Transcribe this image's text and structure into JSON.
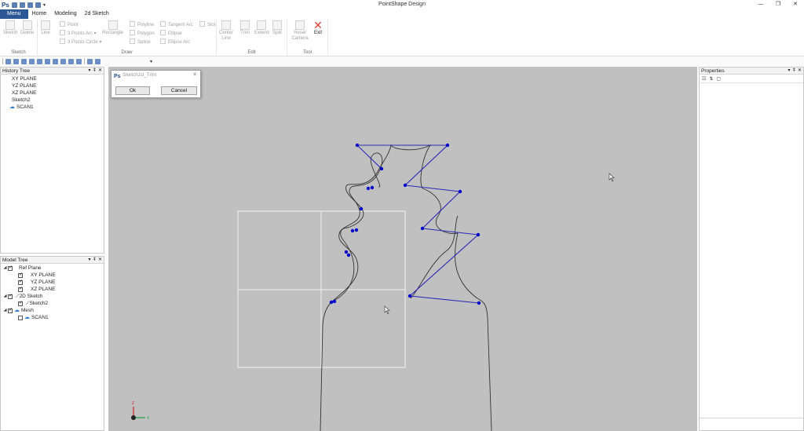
{
  "app": {
    "title": "PointShape Design",
    "logo": "Ps"
  },
  "window": {
    "minimize": "—",
    "restore": "❐",
    "close": "✕"
  },
  "tabs": [
    {
      "label": "Menu"
    },
    {
      "label": "Home"
    },
    {
      "label": "Modeling"
    },
    {
      "label": "2d Sketch"
    }
  ],
  "ribbon": {
    "sketch": {
      "label": "Sketch",
      "buttons": [
        {
          "label": "Sketch"
        },
        {
          "label": "Delete"
        }
      ]
    },
    "draw": {
      "label": "Draw",
      "line": "Line",
      "point": "Point",
      "three_points_arc": "3 Points Arc ▾",
      "three_points_circle": "3 Points Circle ▾",
      "rectangle": "Rectangle",
      "polyline": "Polyline",
      "polygon": "Polygon",
      "spline": "Spline",
      "tangent_arc": "Tangent Arc",
      "ellipse": "Ellipse",
      "ellipse_arc": "Ellipse Arc",
      "slot": "Slot"
    },
    "edit": {
      "label": "Edit",
      "center_line": "Center Line",
      "trim": "Trim",
      "extend": "Extend",
      "split": "Split"
    },
    "tool": {
      "label": "Tool",
      "reset_camera": "Reset Camera",
      "exit": "Exit"
    }
  },
  "history_tree": {
    "title": "History Tree",
    "items": [
      "XY PLANE",
      "YZ PLANE",
      "XZ PLANE",
      "Sketch2",
      "SCAN1"
    ]
  },
  "model_tree": {
    "title": "Model Tree",
    "ref_plane": "Ref Plane",
    "planes": [
      "XY PLANE",
      "YZ PLANE",
      "XZ PLANE"
    ],
    "sketch_group": "2D Sketch",
    "sketch_item": "Sketch2",
    "mesh_group": "Mesh",
    "mesh_item": "SCAN1"
  },
  "properties": {
    "title": "Properties"
  },
  "dialog": {
    "title": "Sketch2d_Trim",
    "ok": "Ok",
    "cancel": "Cancel"
  },
  "axes": {
    "z": "Z",
    "x": "X"
  },
  "colors": {
    "menu_tab": "#2b5797",
    "viewport_bg": "#c0c0c0",
    "sketch_line": "#2a2ab8",
    "sketch_point": "#0000cc",
    "exit_icon": "#e04030"
  },
  "icons": {
    "exit": "close-icon",
    "scan": "cloud-icon"
  }
}
